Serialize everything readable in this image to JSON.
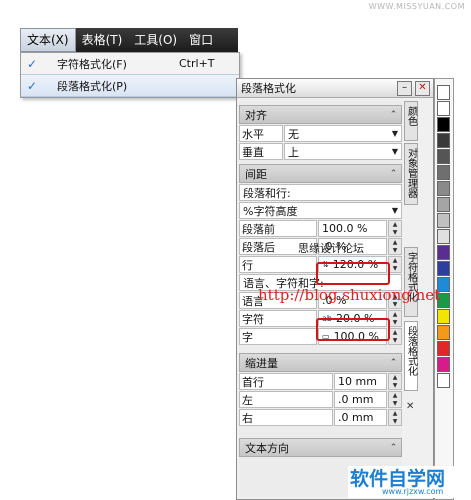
{
  "watermark": {
    "top_url": "WWW.MISSYUAN.COM",
    "cn_site": "思缘设计论坛",
    "url": "http://blog.shuxiong.net",
    "logo": "软件自学网",
    "logo_url": "www.rjzxw.com"
  },
  "menubar": {
    "items": [
      "文本(X)",
      "表格(T)",
      "工具(O)",
      "窗口"
    ]
  },
  "dropdown": {
    "items": [
      {
        "label": "字符格式化(F)",
        "shortcut": "Ctrl+T",
        "check": "✓"
      },
      {
        "label": "段落格式化(P)",
        "shortcut": "",
        "check": "✓"
      }
    ]
  },
  "docker": {
    "title": "段落格式化",
    "sections": {
      "align": {
        "title": "对齐",
        "horizontal_label": "水平",
        "horizontal_value": "无",
        "vertical_label": "垂直",
        "vertical_value": "上"
      },
      "spacing": {
        "title": "间距",
        "para_line_label": "段落和行:",
        "unit_value": "%字符高度",
        "before_label": "段落前",
        "before_value": "100.0 %",
        "after_label": "段落后",
        "after_value": ".0 %",
        "line_label": "行",
        "line_value": "120.0 %",
        "lang_char_label": "语言、字符和字:",
        "lang_label": "语言",
        "lang_value": ".0 %",
        "char_label": "字符",
        "char_value": "20.0 %",
        "word_label": "字",
        "word_value": "100.0 %"
      },
      "indent": {
        "title": "缩进量",
        "first_label": "首行",
        "first_value": "10 mm",
        "left_label": "左",
        "left_value": ".0 mm",
        "right_label": "右",
        "right_value": ".0 mm"
      },
      "direction": {
        "title": "文本方向"
      }
    },
    "tabs": [
      "颜色",
      "对象管理器",
      "字符格式化",
      "段落格式化"
    ]
  },
  "palette": {
    "colors": [
      "#ffffff",
      "#ffffff",
      "#000000",
      "#3a3a3a",
      "#555555",
      "#6f6f6f",
      "#8a8a8a",
      "#a5a5a5",
      "#c0c0c0",
      "#e0e0e0",
      "#5a2d91",
      "#2e3e9e",
      "#1f8ad6",
      "#1a9a45",
      "#f2e600",
      "#f39a1a",
      "#e02828",
      "#d81b8a",
      "#ffffff"
    ]
  }
}
